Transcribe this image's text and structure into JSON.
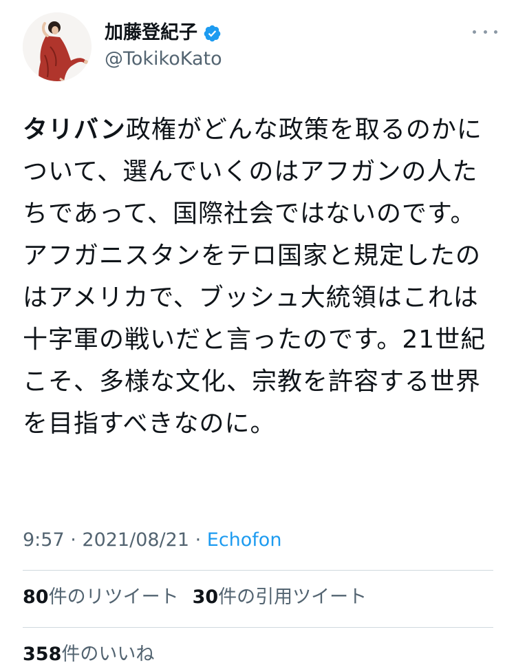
{
  "author": {
    "display_name": "加藤登紀子",
    "handle": "@TokikoKato",
    "verified": true
  },
  "tweet": {
    "bold_lead": "タリバン",
    "text_rest": "政権がどんな政策を取るのかについて、選んでいくのはアフガンの人たちであって、国際社会ではないのです。アフガニスタンをテロ国家と規定したのはアメリカで、ブッシュ大統領はこれは十字軍の戦いだと言ったのです。21世紀こそ、多様な文化、宗教を許容する世界を目指すべきなのに。"
  },
  "meta": {
    "time": "9:57",
    "separator": " · ",
    "date": "2021/08/21",
    "separator2": " · ",
    "source": "Echofon"
  },
  "stats": {
    "retweets_count": "80",
    "retweets_label": "件のリツイート",
    "quotes_count": "30",
    "quotes_label": "件の引用ツイート",
    "likes_count": "358",
    "likes_label": "件のいいね"
  },
  "colors": {
    "verified_blue": "#1d9bf0",
    "link_blue": "#1d9bf0",
    "secondary_text": "#536471",
    "divider": "#cfd9de",
    "avatar_dress": "#b0352c"
  },
  "icons": {
    "verified": "verified-badge-icon",
    "more": "more-options-icon"
  }
}
